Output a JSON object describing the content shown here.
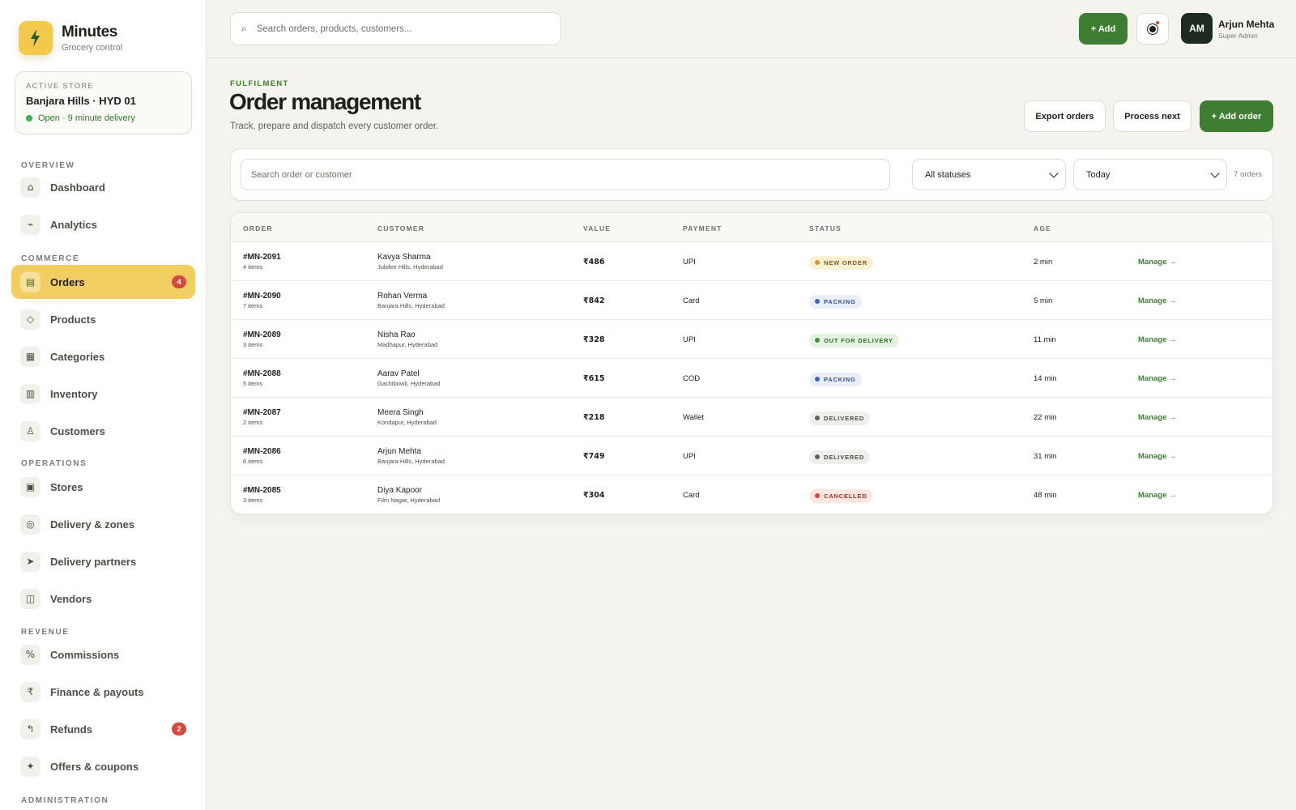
{
  "brand": {
    "name": "Minutes",
    "subtitle": "Grocery control",
    "logo_icon": "lightning-bolt-icon"
  },
  "store": {
    "label": "ACTIVE STORE",
    "name": "Banjara Hills · HYD 01",
    "status": "Open · 9 minute delivery"
  },
  "nav": {
    "sections": [
      "OVERVIEW",
      "COMMERCE",
      "OPERATIONS",
      "REVENUE",
      "ADMINISTRATION"
    ],
    "items": [
      {
        "label": "Dashboard",
        "icon": "⌂",
        "icon_name": "home-icon"
      },
      {
        "label": "Analytics",
        "icon": "⌁",
        "icon_name": "analytics-icon"
      },
      {
        "label": "Orders",
        "icon": "▤",
        "icon_name": "orders-icon",
        "badge": "4",
        "active": true
      },
      {
        "label": "Products",
        "icon": "◇",
        "icon_name": "products-icon"
      },
      {
        "label": "Categories",
        "icon": "▦",
        "icon_name": "categories-icon"
      },
      {
        "label": "Inventory",
        "icon": "▥",
        "icon_name": "inventory-icon"
      },
      {
        "label": "Customers",
        "icon": "♙",
        "icon_name": "customers-icon"
      },
      {
        "label": "Stores",
        "icon": "▣",
        "icon_name": "stores-icon"
      },
      {
        "label": "Delivery & zones",
        "icon": "◎",
        "icon_name": "zones-icon"
      },
      {
        "label": "Delivery partners",
        "icon": "➤",
        "icon_name": "delivery-partners-icon"
      },
      {
        "label": "Vendors",
        "icon": "◫",
        "icon_name": "vendors-icon"
      },
      {
        "label": "Commissions",
        "icon": "%",
        "icon_name": "commissions-icon"
      },
      {
        "label": "Finance & payouts",
        "icon": "₹",
        "icon_name": "finance-icon"
      },
      {
        "label": "Refunds",
        "icon": "↰",
        "icon_name": "refunds-icon",
        "badge": "2"
      },
      {
        "label": "Offers & coupons",
        "icon": "✦",
        "icon_name": "offers-icon"
      }
    ]
  },
  "topbar": {
    "search_placeholder": "Search orders, products, customers...",
    "search_icon": "⌕",
    "add_label": "+ Add",
    "user_initials": "AM",
    "user_name": "Arjun Mehta",
    "user_role": "Super Admin"
  },
  "header": {
    "eyebrow": "FULFILMENT",
    "title": "Order management",
    "subtitle": "Track, prepare and dispatch every customer order.",
    "export_label": "Export orders",
    "process_label": "Process next",
    "add_order_label": "+ Add order"
  },
  "filters": {
    "search_placeholder": "Search order or customer",
    "status_value": "All statuses",
    "date_value": "Today",
    "count_text": "7 orders"
  },
  "colors": {
    "accent_green": "#3e7d32",
    "accent_yellow": "#f2cd62",
    "badge_red": "#d7483c"
  },
  "table": {
    "columns": [
      "ORDER",
      "CUSTOMER",
      "VALUE",
      "PAYMENT",
      "STATUS",
      "AGE"
    ],
    "rows": [
      {
        "id": "#MN-2091",
        "items": "4 items",
        "customer": "Kavya Sharma",
        "area": "Jubilee Hills, Hyderabad",
        "value": "₹486",
        "payment": "UPI",
        "status": "NEW ORDER",
        "status_kind": "new",
        "age": "2 min",
        "action": "Manage →"
      },
      {
        "id": "#MN-2090",
        "items": "7 items",
        "customer": "Rohan Verma",
        "area": "Banjara Hills, Hyderabad",
        "value": "₹842",
        "payment": "Card",
        "status": "PACKING",
        "status_kind": "packing",
        "age": "5 min",
        "action": "Manage →"
      },
      {
        "id": "#MN-2089",
        "items": "3 items",
        "customer": "Nisha Rao",
        "area": "Madhapur, Hyderabad",
        "value": "₹328",
        "payment": "UPI",
        "status": "OUT FOR DELIVERY",
        "status_kind": "out",
        "age": "11 min",
        "action": "Manage →"
      },
      {
        "id": "#MN-2088",
        "items": "5 items",
        "customer": "Aarav Patel",
        "area": "Gachibowli, Hyderabad",
        "value": "₹615",
        "payment": "COD",
        "status": "PACKING",
        "status_kind": "packing",
        "age": "14 min",
        "action": "Manage →"
      },
      {
        "id": "#MN-2087",
        "items": "2 items",
        "customer": "Meera Singh",
        "area": "Kondapur, Hyderabad",
        "value": "₹218",
        "payment": "Wallet",
        "status": "DELIVERED",
        "status_kind": "delivered",
        "age": "22 min",
        "action": "Manage →"
      },
      {
        "id": "#MN-2086",
        "items": "6 items",
        "customer": "Arjun Mehta",
        "area": "Banjara Hills, Hyderabad",
        "value": "₹749",
        "payment": "UPI",
        "status": "DELIVERED",
        "status_kind": "delivered",
        "age": "31 min",
        "action": "Manage →"
      },
      {
        "id": "#MN-2085",
        "items": "3 items",
        "customer": "Diya Kapoor",
        "area": "Film Nagar, Hyderabad",
        "value": "₹304",
        "payment": "Card",
        "status": "CANCELLED",
        "status_kind": "cancelled",
        "age": "48 min",
        "action": "Manage →"
      }
    ],
    "status_styles": {
      "new": {
        "bg": "#fbf0d6",
        "fg": "#8a5b12",
        "dot": "#d69a1f"
      },
      "packing": {
        "bg": "#e9eef9",
        "fg": "#334e8f",
        "dot": "#3f63c4"
      },
      "out": {
        "bg": "#e6f2e1",
        "fg": "#2f6b28",
        "dot": "#3e8f34"
      },
      "delivered": {
        "bg": "#eeeeea",
        "fg": "#4b4f45",
        "dot": "#60635a"
      },
      "cancelled": {
        "bg": "#fbe6e2",
        "fg": "#a23327",
        "dot": "#d7483c"
      }
    }
  }
}
